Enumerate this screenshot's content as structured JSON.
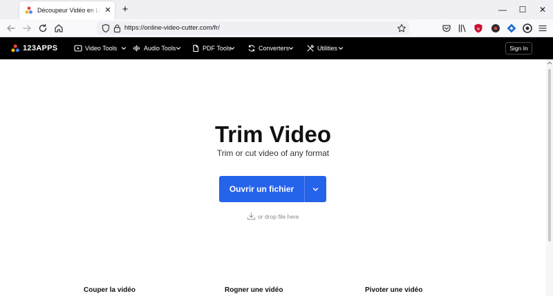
{
  "browser": {
    "tab_title": "Découpeur Vidéo en Ligne - Dé",
    "tab_close": "✕",
    "new_tab": "+",
    "url": "https://online-video-cutter.com/fr/",
    "window_controls": {
      "minimize": "—",
      "maximize": "☐",
      "close": "✕"
    },
    "toolbar_icons": [
      "back-icon",
      "forward-icon",
      "reload-icon",
      "home-icon",
      "shield-icon",
      "lock-icon",
      "bookmark-star-icon",
      "pocket-icon",
      "library-icon",
      "extension-icons",
      "menu-icon"
    ]
  },
  "site_nav": {
    "logo": "123APPS",
    "items": [
      {
        "label": "Video Tools",
        "icon": "video-icon"
      },
      {
        "label": "Audio Tools",
        "icon": "audio-wave-icon"
      },
      {
        "label": "PDF Tools",
        "icon": "pdf-icon"
      },
      {
        "label": "Converters",
        "icon": "converter-icon"
      },
      {
        "label": "Utilities",
        "icon": "tools-icon"
      }
    ],
    "signin": "Sign In"
  },
  "main": {
    "title": "Trim Video",
    "subtitle": "Trim or cut video of any format",
    "open_button": "Ouvrir un fichier",
    "drop_text": "or drop file here"
  },
  "features": [
    "Couper la vidéo",
    "Rogner une vidéo",
    "Pivoter une vidéo"
  ],
  "colors": {
    "nav_background": "#000000",
    "accent_button": "#2563eb",
    "page_background": "#ffffff",
    "logo_dots": [
      "#f4b400",
      "#4285f4",
      "#ea4335"
    ]
  }
}
